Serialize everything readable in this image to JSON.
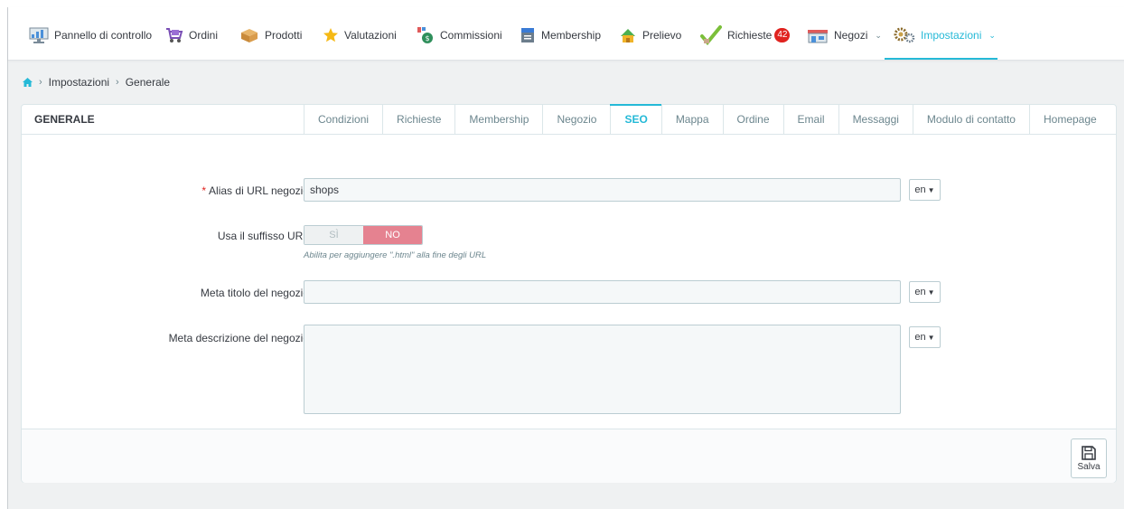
{
  "nav": {
    "items": [
      {
        "label": "Pannello di controllo",
        "icon": "dashboard-icon"
      },
      {
        "label": "Ordini",
        "icon": "orders-cart-icon"
      },
      {
        "label": "Prodotti",
        "icon": "products-box-icon"
      },
      {
        "label": "Valutazioni",
        "icon": "star-icon"
      },
      {
        "label": "Commissioni",
        "icon": "money-bag-icon"
      },
      {
        "label": "Membership",
        "icon": "membership-icon"
      },
      {
        "label": "Prelievo",
        "icon": "withdraw-icon"
      },
      {
        "label": "Richieste",
        "icon": "checkmark-icon",
        "badge": "42"
      },
      {
        "label": "Negozi",
        "icon": "shop-icon"
      },
      {
        "label": "Impostazioni",
        "icon": "settings-gears-icon",
        "active": true
      }
    ],
    "accent_color": "#25b9d7",
    "badge_color": "#e0231f"
  },
  "breadcrumb": {
    "home_icon": "home-icon",
    "items": [
      "Impostazioni",
      "Generale"
    ]
  },
  "panel": {
    "title": "GENERALE",
    "tabs": [
      {
        "label": "Condizioni"
      },
      {
        "label": "Richieste"
      },
      {
        "label": "Membership"
      },
      {
        "label": "Negozio"
      },
      {
        "label": "SEO",
        "active": true
      },
      {
        "label": "Mappa"
      },
      {
        "label": "Ordine"
      },
      {
        "label": "Email"
      },
      {
        "label": "Messaggi"
      },
      {
        "label": "Modulo di contatto"
      },
      {
        "label": "Homepage"
      }
    ]
  },
  "form": {
    "url_alias": {
      "label": "Alias di URL negozio",
      "required_mark": "*",
      "value": "shops",
      "lang": "en"
    },
    "url_suffix": {
      "label": "Usa il suffisso URL",
      "yes_label": "SÌ",
      "no_label": "NO",
      "selected": "NO",
      "help": "Abilita per aggiungere \".html\" alla fine degli URL"
    },
    "meta_title": {
      "label": "Meta titolo del negozio",
      "value": "",
      "lang": "en"
    },
    "meta_description": {
      "label": "Meta descrizione del negozio",
      "value": "",
      "lang": "en"
    }
  },
  "footer": {
    "save_label": "Salva",
    "save_icon": "floppy-disk-icon"
  }
}
